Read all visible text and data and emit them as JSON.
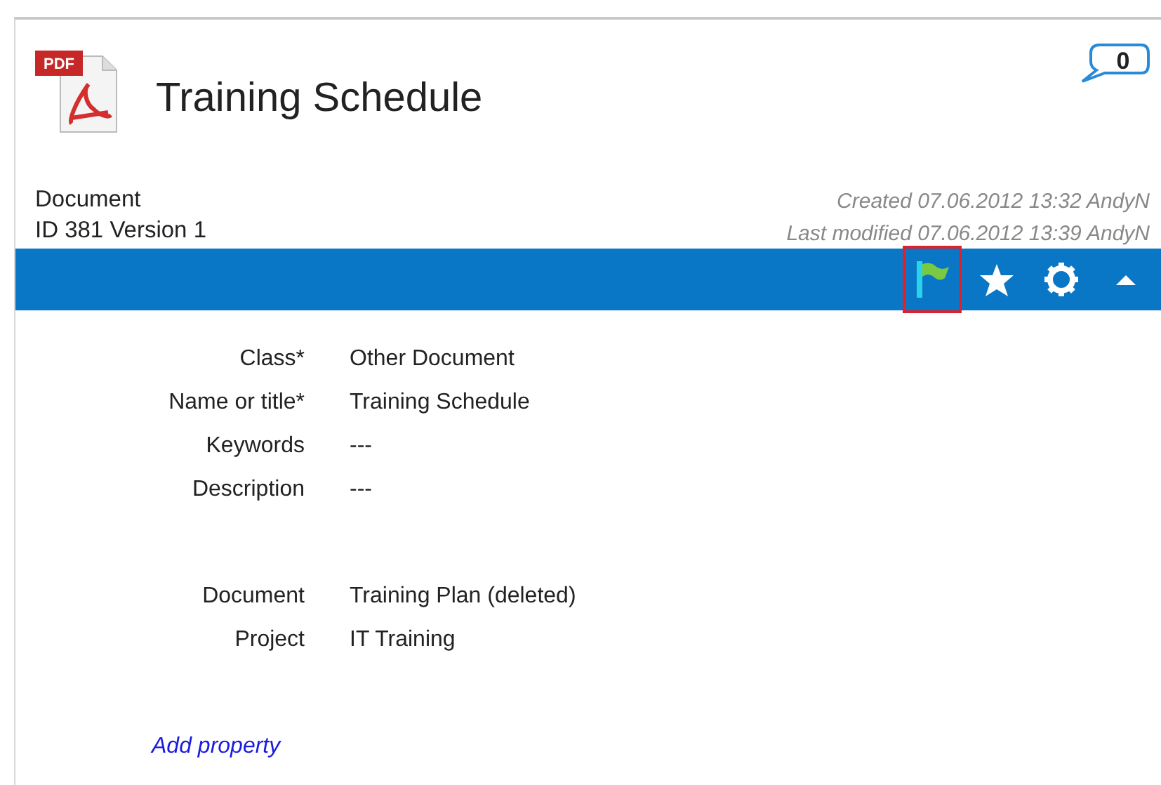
{
  "header": {
    "file_type": "PDF",
    "title": "Training Schedule",
    "comment_count": "0"
  },
  "info": {
    "type": "Document",
    "id_version": "ID 381  Version 1",
    "created": "Created 07.06.2012 13:32 AndyN",
    "modified": "Last modified 07.06.2012 13:39 AndyN"
  },
  "toolbar": [
    {
      "kind": "flag",
      "highlighted": true
    },
    {
      "kind": "star",
      "highlighted": false
    },
    {
      "kind": "gear",
      "highlighted": false
    },
    {
      "kind": "caret",
      "highlighted": false
    }
  ],
  "property_groups": [
    [
      {
        "label": "Class*",
        "value": "Other Document"
      },
      {
        "label": "Name or title*",
        "value": "Training Schedule"
      },
      {
        "label": "Keywords",
        "value": "---"
      },
      {
        "label": "Description",
        "value": "---"
      }
    ],
    [
      {
        "label": "Document",
        "value": "Training Plan (deleted)"
      },
      {
        "label": "Project",
        "value": "IT Training"
      }
    ]
  ],
  "add_property_link": "Add property"
}
